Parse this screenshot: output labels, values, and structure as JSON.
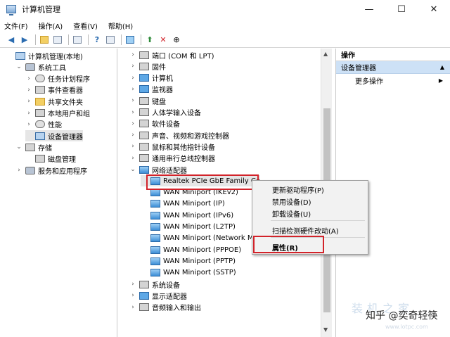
{
  "window": {
    "title": "计算机管理"
  },
  "window_controls": {
    "minimize": "—",
    "maximize": "☐",
    "close": "✕"
  },
  "menu": [
    "文件(F)",
    "操作(A)",
    "查看(V)",
    "帮助(H)"
  ],
  "left_tree": [
    {
      "label": "计算机管理(本地)",
      "indent": 0,
      "expander": "",
      "icon": "comp"
    },
    {
      "label": "系统工具",
      "indent": 1,
      "expander": "⌄",
      "icon": "tool"
    },
    {
      "label": "任务计划程序",
      "indent": 2,
      "expander": "›",
      "icon": "round"
    },
    {
      "label": "事件查看器",
      "indent": 2,
      "expander": "›",
      "icon": "dev"
    },
    {
      "label": "共享文件夹",
      "indent": 2,
      "expander": "›",
      "icon": "folder"
    },
    {
      "label": "本地用户和组",
      "indent": 2,
      "expander": "›",
      "icon": "dev"
    },
    {
      "label": "性能",
      "indent": 2,
      "expander": "›",
      "icon": "round"
    },
    {
      "label": "设备管理器",
      "indent": 2,
      "expander": "",
      "icon": "comp",
      "selected": true
    },
    {
      "label": "存储",
      "indent": 1,
      "expander": "⌄",
      "icon": "dev"
    },
    {
      "label": "磁盘管理",
      "indent": 2,
      "expander": "",
      "icon": "dev"
    },
    {
      "label": "服务和应用程序",
      "indent": 1,
      "expander": "›",
      "icon": "tool"
    }
  ],
  "device_tree": [
    {
      "label": "端口 (COM 和 LPT)",
      "indent": 0,
      "expander": "›",
      "icon": "dev"
    },
    {
      "label": "固件",
      "indent": 0,
      "expander": "›",
      "icon": "dev"
    },
    {
      "label": "计算机",
      "indent": 0,
      "expander": "›",
      "icon": "mon"
    },
    {
      "label": "监视器",
      "indent": 0,
      "expander": "›",
      "icon": "mon"
    },
    {
      "label": "键盘",
      "indent": 0,
      "expander": "›",
      "icon": "dev"
    },
    {
      "label": "人体学输入设备",
      "indent": 0,
      "expander": "›",
      "icon": "dev"
    },
    {
      "label": "软件设备",
      "indent": 0,
      "expander": "›",
      "icon": "dev"
    },
    {
      "label": "声音、视频和游戏控制器",
      "indent": 0,
      "expander": "›",
      "icon": "dev"
    },
    {
      "label": "鼠标和其他指针设备",
      "indent": 0,
      "expander": "›",
      "icon": "dev"
    },
    {
      "label": "通用串行总线控制器",
      "indent": 0,
      "expander": "›",
      "icon": "dev"
    },
    {
      "label": "网络适配器",
      "indent": 0,
      "expander": "⌄",
      "icon": "net"
    },
    {
      "label": "Realtek PCIe GbE Family Co",
      "indent": 1,
      "expander": "",
      "icon": "net",
      "selected": true
    },
    {
      "label": "WAN Miniport (IKEv2)",
      "indent": 1,
      "expander": "",
      "icon": "net"
    },
    {
      "label": "WAN Miniport (IP)",
      "indent": 1,
      "expander": "",
      "icon": "net"
    },
    {
      "label": "WAN Miniport (IPv6)",
      "indent": 1,
      "expander": "",
      "icon": "net"
    },
    {
      "label": "WAN Miniport (L2TP)",
      "indent": 1,
      "expander": "",
      "icon": "net"
    },
    {
      "label": "WAN Miniport (Network M",
      "indent": 1,
      "expander": "",
      "icon": "net"
    },
    {
      "label": "WAN Miniport (PPPOE)",
      "indent": 1,
      "expander": "",
      "icon": "net"
    },
    {
      "label": "WAN Miniport (PPTP)",
      "indent": 1,
      "expander": "",
      "icon": "net"
    },
    {
      "label": "WAN Miniport (SSTP)",
      "indent": 1,
      "expander": "",
      "icon": "net"
    },
    {
      "label": "系统设备",
      "indent": 0,
      "expander": "›",
      "icon": "dev"
    },
    {
      "label": "显示适配器",
      "indent": 0,
      "expander": "›",
      "icon": "mon"
    },
    {
      "label": "音频输入和输出",
      "indent": 0,
      "expander": "›",
      "icon": "dev"
    }
  ],
  "context_menu": [
    {
      "label": "更新驱动程序(P)"
    },
    {
      "label": "禁用设备(D)"
    },
    {
      "label": "卸载设备(U)"
    },
    {
      "label": "扫描检测硬件改动(A)"
    },
    {
      "label": "属性(R)",
      "bold": true
    }
  ],
  "actions": {
    "header": "操作",
    "selected": "设备管理器",
    "more": "更多操作"
  },
  "watermark": {
    "text": "知乎 @奕奇轻筷",
    "faint": "装机之家",
    "faint_url": "www.lotpc.com"
  },
  "colors": {
    "highlight_red": "#d2232a",
    "selection_blue": "#cde1f6"
  }
}
